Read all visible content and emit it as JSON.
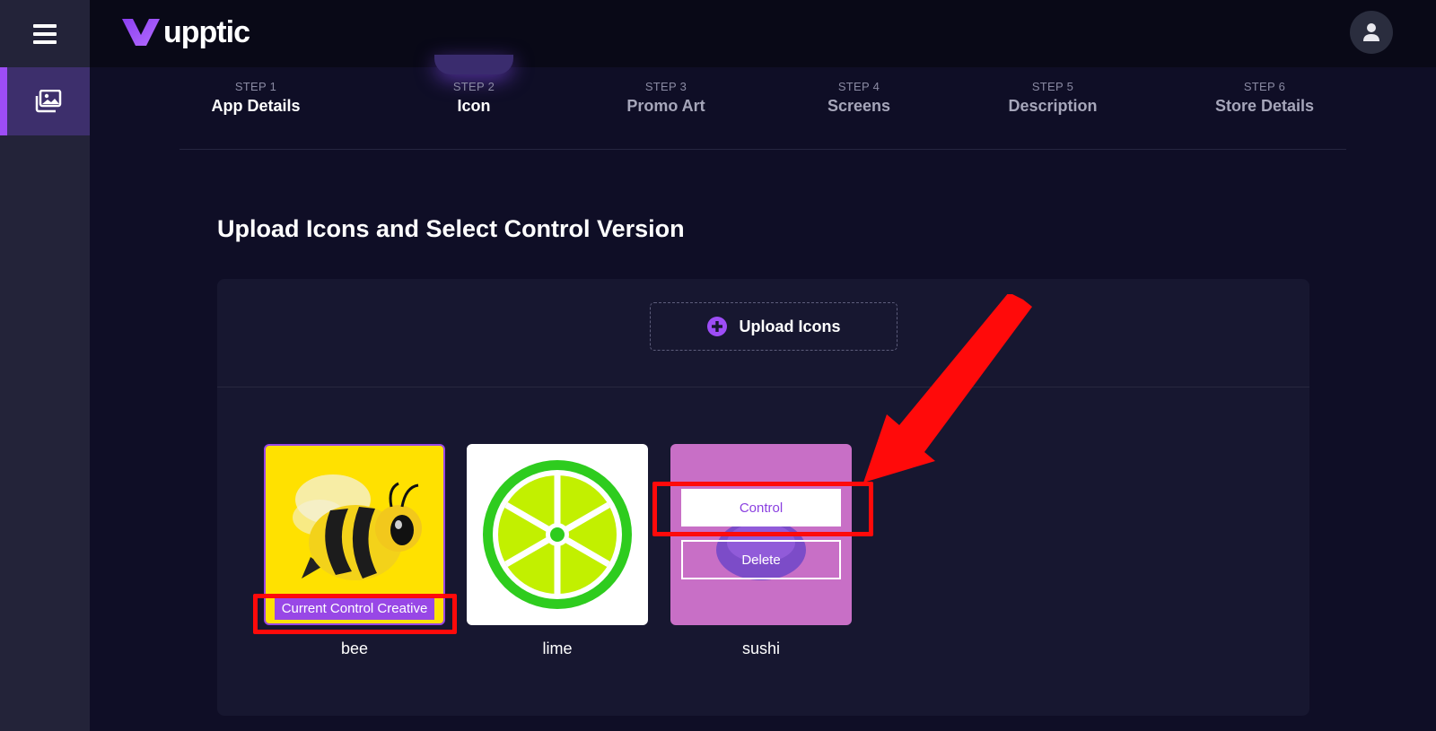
{
  "app": {
    "logo_text": "upptic"
  },
  "steps": [
    {
      "num": "STEP 1",
      "name": "App Details"
    },
    {
      "num": "STEP 2",
      "name": "Icon"
    },
    {
      "num": "STEP 3",
      "name": "Promo Art"
    },
    {
      "num": "STEP 4",
      "name": "Screens"
    },
    {
      "num": "STEP 5",
      "name": "Description"
    },
    {
      "num": "STEP 6",
      "name": "Store Details"
    }
  ],
  "page": {
    "title": "Upload Icons and Select Control Version"
  },
  "upload": {
    "label": "Upload Icons"
  },
  "icons": [
    {
      "name": "bee",
      "badge": "Current Control Creative"
    },
    {
      "name": "lime"
    },
    {
      "name": "sushi",
      "control_label": "Control",
      "delete_label": "Delete"
    }
  ],
  "colors": {
    "accent": "#9d4df6",
    "badge": "#9847e6",
    "highlight": "#ff0a0a",
    "background": "#0f0e26"
  }
}
